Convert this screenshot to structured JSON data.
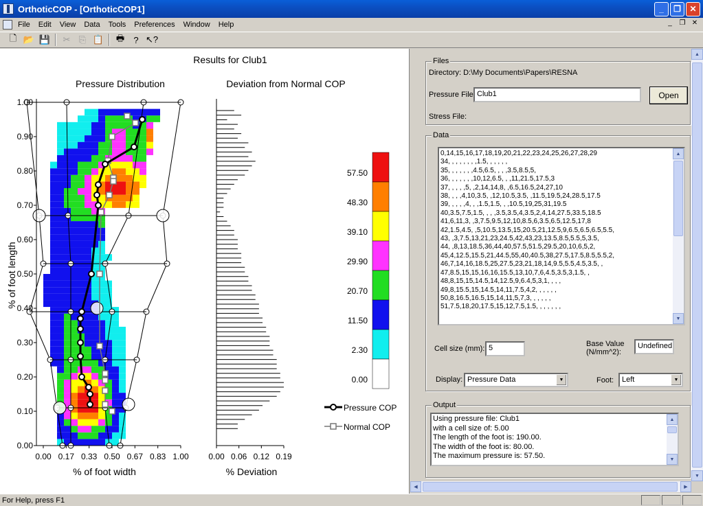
{
  "window": {
    "title": "OrthoticCOP - [OrthoticCOP1]"
  },
  "menu": [
    "File",
    "Edit",
    "View",
    "Data",
    "Tools",
    "Preferences",
    "Window",
    "Help"
  ],
  "toolbar": {
    "icons": [
      "new-icon",
      "open-icon",
      "save-icon",
      "cut-icon",
      "copy-icon",
      "paste-icon",
      "print-icon",
      "help-icon",
      "context-help-icon"
    ]
  },
  "plot": {
    "title": "Results for Club1",
    "left_title": "Pressure Distribution",
    "right_title": "Deviation from Normal COP",
    "y_label": "% of foot length",
    "x_label": "% of foot width",
    "dev_label": "% Deviation",
    "y_ticks": [
      "1.00",
      "0.90",
      "0.80",
      "0.70",
      "0.60",
      "0.50",
      "0.40",
      "0.30",
      "0.20",
      "0.10",
      "0.00"
    ],
    "x_ticks": [
      "0.00",
      "0.17",
      "0.33",
      "0.50",
      "0.67",
      "0.83",
      "1.00"
    ],
    "dev_ticks": [
      "0.00",
      "0.06",
      "0.12",
      "0.19"
    ],
    "scale_labels": [
      "57.50",
      "48.30",
      "39.10",
      "29.90",
      "20.70",
      "11.50",
      "2.30",
      "0.00"
    ],
    "scale_colors": [
      "#ee1111",
      "#ff7f00",
      "#ffff00",
      "#ff33ff",
      "#22dd22",
      "#1111ee",
      "#11eeee",
      "#ffffff"
    ],
    "legend": {
      "pressure": "Pressure COP",
      "normal": "Normal COP"
    },
    "pressure_cop": [
      [
        0.72,
        0.95
      ],
      [
        0.66,
        0.87
      ],
      [
        0.45,
        0.82
      ],
      [
        0.4,
        0.76
      ],
      [
        0.39,
        0.73
      ],
      [
        0.4,
        0.7
      ],
      [
        0.35,
        0.5
      ],
      [
        0.28,
        0.39
      ],
      [
        0.27,
        0.37
      ],
      [
        0.27,
        0.34
      ],
      [
        0.27,
        0.3
      ],
      [
        0.27,
        0.26
      ],
      [
        0.28,
        0.2
      ],
      [
        0.33,
        0.17
      ],
      [
        0.34,
        0.15
      ],
      [
        0.34,
        0.12
      ]
    ],
    "normal_cop": [
      [
        0.61,
        0.96
      ],
      [
        0.67,
        0.94
      ],
      [
        0.5,
        0.9
      ],
      [
        0.47,
        0.83
      ],
      [
        0.51,
        0.78
      ],
      [
        0.51,
        0.77
      ],
      [
        0.48,
        0.73
      ],
      [
        0.42,
        0.68
      ],
      [
        0.41,
        0.5
      ],
      [
        0.41,
        0.29
      ],
      [
        0.45,
        0.21
      ],
      [
        0.45,
        0.19
      ],
      [
        0.45,
        0.16
      ],
      [
        0.45,
        0.12
      ],
      [
        0.5,
        0.1
      ]
    ],
    "deviation": [
      0.05,
      0.07,
      0.03,
      0.06,
      0.05,
      0.07,
      0.06,
      0.09,
      0.08,
      0.1,
      0.09,
      0.11,
      0.1,
      0.09,
      0.08,
      0.06,
      0.05,
      0.04,
      0.03,
      0.02,
      0.02,
      0.02,
      0.01,
      0.02,
      0.03,
      0.04,
      0.05,
      0.05,
      0.06,
      0.06,
      0.06,
      0.07,
      0.07,
      0.07,
      0.08,
      0.08,
      0.09,
      0.09,
      0.1,
      0.1,
      0.11,
      0.11,
      0.12,
      0.12,
      0.12,
      0.13,
      0.13,
      0.14,
      0.14,
      0.15,
      0.15,
      0.15,
      0.16,
      0.16,
      0.17,
      0.17,
      0.17,
      0.18,
      0.18,
      0.19,
      0.19,
      0.18,
      0.17,
      0.15,
      0.13,
      0.12,
      0.1,
      0.08,
      0.06,
      0.06
    ]
  },
  "files": {
    "group": "Files",
    "directory": "Directory: D:\\My Documents\\Papers\\RESNA",
    "pressure_label": "Pressure File:",
    "pressure_value": "Club1",
    "open_label": "Open",
    "stress_label": "Stress File:"
  },
  "data_group": {
    "group": "Data",
    "lines": [
      "0,14,15,16,17,18,19,20,21,22,23,24,25,26,27,28,29",
      "34, , , , , , , ,1.5, , , , , ,",
      "35, , , , , , ,4.5,6.5, , , ,3.5,8.5,5,",
      "36, , , , , , ,10,12,6.5, , ,11,21.5,17.5,3",
      "37, , , , ,5, ,2,14,14,8, ,6.5,16.5,24,27,10",
      "38, , , ,4,10,3.5, ,12,10.5,3.5, ,11.5,19.5,24,28.5,17.5",
      "39, , , , ,4, , ,1.5,1.5, , ,10.5,19,25,31,19.5",
      "40,3.5,7.5,1.5, , , ,3.5,3.5,4,3.5,2,4,14,27.5,33.5,18.5",
      "41,6,11,3, ,3,7.5,9.5,12,10,8.5,6,3.5,6.5,12.5,17,8",
      "42,1.5,4.5, ,5,10.5,13.5,15,20.5,21,12.5,9,6.5,6.5,6.5,5.5,",
      "43, ,3,7.5,13,21,23,24.5,42,43,23,13.5,8.5,5.5,5,3.5,",
      "44, ,8,13,18.5,36,44,40,57.5,51.5,29.5,20,10,6,5,2,",
      "45,4,12.5,15.5,21,44.5,55,40,40.5,38,27.5,17.5,8.5,5.5,2,",
      "46,7,14,16,18.5,25,27.5,23,21,18,14,9.5,5.5,4.5,3.5, ,",
      "47,8.5,15,15,16,16,15.5,13,10,7,6,4.5,3.5,3,1.5, ,",
      "48,8,15,15,14.5,14,12.5,9,6.4,5,3,1, , , ,",
      "49,8,15.5,15,14.5,14,11,7.5,4,2, , , , , ,",
      "50,8,16.5,16.5,15,14,11,5,7,3, , , , , ,",
      "51,7.5,18,20,17.5,15,12,7.5,1.5, , , , , , ,"
    ],
    "cell_size_label": "Cell size (mm):",
    "cell_size_value": "5",
    "base_value_label": "Base Value (N/mm^2):",
    "base_value": "Undefined",
    "display_label": "Display:",
    "display_value": "Pressure Data",
    "foot_label": "Foot:",
    "foot_value": "Left"
  },
  "output": {
    "group": "Output",
    "lines": [
      "Using pressure file: Club1",
      "with a cell size of: 5.00",
      "The length of the foot is: 190.00.",
      "The width of the foot is: 80.00.",
      "The maximum pressure is: 57.50."
    ]
  },
  "status": {
    "text": "For Help, press F1"
  }
}
